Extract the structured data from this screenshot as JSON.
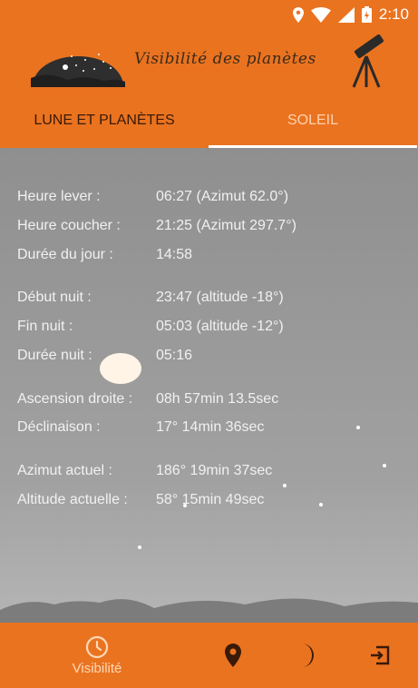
{
  "status": {
    "time": "2:10"
  },
  "app": {
    "title": "Visibilité des planètes"
  },
  "tabs": [
    {
      "label": "LUNE ET PLANÈTES",
      "active": false
    },
    {
      "label": "SOLEIL",
      "active": true
    }
  ],
  "sun": {
    "rows": [
      {
        "label": "Heure lever :",
        "value": "06:27   (Azimut 62.0°)"
      },
      {
        "label": "Heure coucher :",
        "value": "21:25   (Azimut 297.7°)"
      },
      {
        "label": "Durée du jour :",
        "value": "14:58"
      },
      {
        "label": "Début nuit :",
        "value": "23:47 (altitude -18°)"
      },
      {
        "label": "Fin nuit :",
        "value": "05:03 (altitude -12°)"
      },
      {
        "label": "Durée nuit :",
        "value": "05:16"
      },
      {
        "label": "Ascension droite :",
        "value": "08h  57min  13.5sec"
      },
      {
        "label": "Déclinaison :",
        "value": "17°  14min  36sec"
      },
      {
        "label": "Azimut actuel :",
        "value": "186°  19min  37sec"
      },
      {
        "label": "Altitude actuelle :",
        "value": "58°  15min  49sec"
      }
    ]
  },
  "bottom_nav": {
    "visibility_label": "Visibilité"
  },
  "colors": {
    "primary": "#ea7320",
    "background": "#9a9a9a"
  }
}
